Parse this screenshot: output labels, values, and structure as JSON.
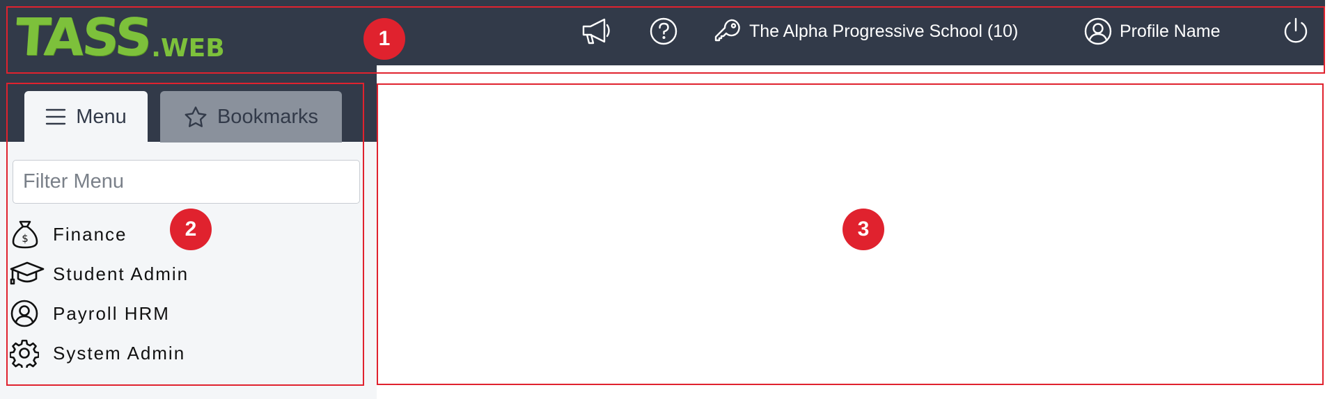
{
  "header": {
    "logo_main": "TASS",
    "logo_suffix": ".WEB",
    "announcements_icon": "megaphone-icon",
    "help_icon": "question-circle-icon",
    "school_icon": "key-icon",
    "school_name": "The Alpha Progressive School (10)",
    "profile_icon": "user-circle-icon",
    "profile_name": "Profile Name",
    "logout_icon": "power-icon"
  },
  "sidebar": {
    "tabs": [
      {
        "label": "Menu",
        "icon": "hamburger-icon",
        "active": true
      },
      {
        "label": "Bookmarks",
        "icon": "star-icon",
        "active": false
      }
    ],
    "filter_placeholder": "Filter Menu",
    "items": [
      {
        "label": "Finance",
        "icon": "money-bag-icon"
      },
      {
        "label": "Student Admin",
        "icon": "graduation-cap-icon"
      },
      {
        "label": "Payroll HRM",
        "icon": "user-circle-icon"
      },
      {
        "label": "System Admin",
        "icon": "gear-icon"
      }
    ]
  },
  "annotations": [
    {
      "number": "1"
    },
    {
      "number": "2"
    },
    {
      "number": "3"
    }
  ],
  "colors": {
    "header_bg": "#323a49",
    "sidebar_bg": "#f4f6f8",
    "logo_green": "#7dc13b",
    "annotation_red": "#e0222e",
    "bookmarks_tab": "#8a919c"
  }
}
